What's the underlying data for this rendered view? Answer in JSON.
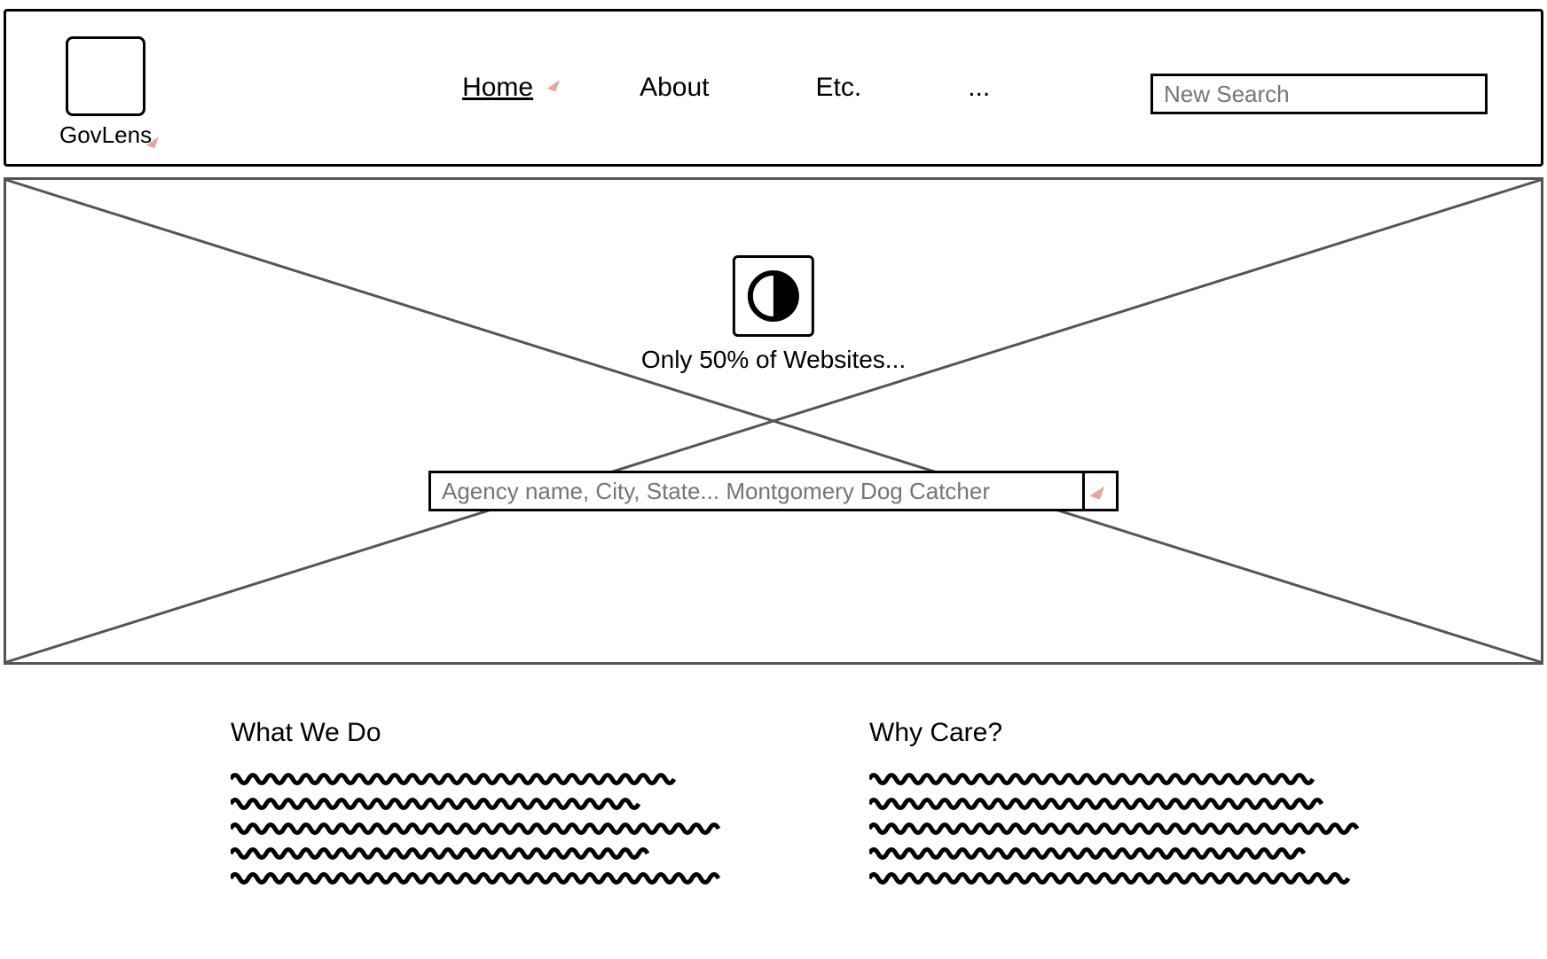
{
  "brand": {
    "name": "GovLens"
  },
  "nav": {
    "items": [
      {
        "label": "Home",
        "active": true
      },
      {
        "label": "About",
        "active": false
      },
      {
        "label": "Etc.",
        "active": false
      },
      {
        "label": "...",
        "active": false
      }
    ]
  },
  "header": {
    "search_placeholder": "New Search"
  },
  "hero": {
    "tagline": "Only 50% of Websites...",
    "search_placeholder": "Agency name, City, State... Montgomery Dog Catcher",
    "icon_name": "contrast-icon"
  },
  "sections": {
    "left": {
      "title": "What We Do"
    },
    "right": {
      "title": "Why Care?"
    }
  }
}
